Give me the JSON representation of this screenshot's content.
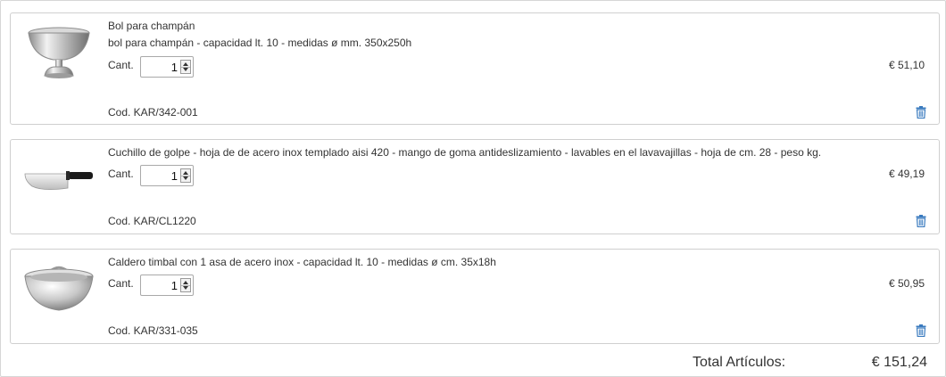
{
  "cart": {
    "items": [
      {
        "title": "Bol para champán",
        "description": "bol para champán - capacidad lt. 10 - medidas ø mm. 350x250h",
        "qty_label": "Cant.",
        "qty": "1",
        "price": "€ 51,10",
        "code": "Cod. KAR/342-001",
        "image_icon": "champagne-bowl-image"
      },
      {
        "title": "Cuchillo de golpe - hoja de de acero inox templado aisi 420 - mango de goma antideslizamiento - lavables en el lavavajillas - hoja de cm. 28 - peso kg.",
        "description": "",
        "qty_label": "Cant.",
        "qty": "1",
        "price": "€ 49,19",
        "code": "Cod. KAR/CL1220",
        "image_icon": "cleaver-knife-image"
      },
      {
        "title": "Caldero timbal con 1 asa de acero inox - capacidad lt. 10 - medidas ø cm. 35x18h",
        "description": "",
        "qty_label": "Cant.",
        "qty": "1",
        "price": "€ 50,95",
        "code": "Cod. KAR/331-035",
        "image_icon": "steel-bowl-image"
      }
    ],
    "total_label": "Total Artículos:",
    "total_value": "€ 151,24"
  },
  "colors": {
    "trash_icon": "#3a7bbf",
    "border": "#cfcfcf"
  }
}
